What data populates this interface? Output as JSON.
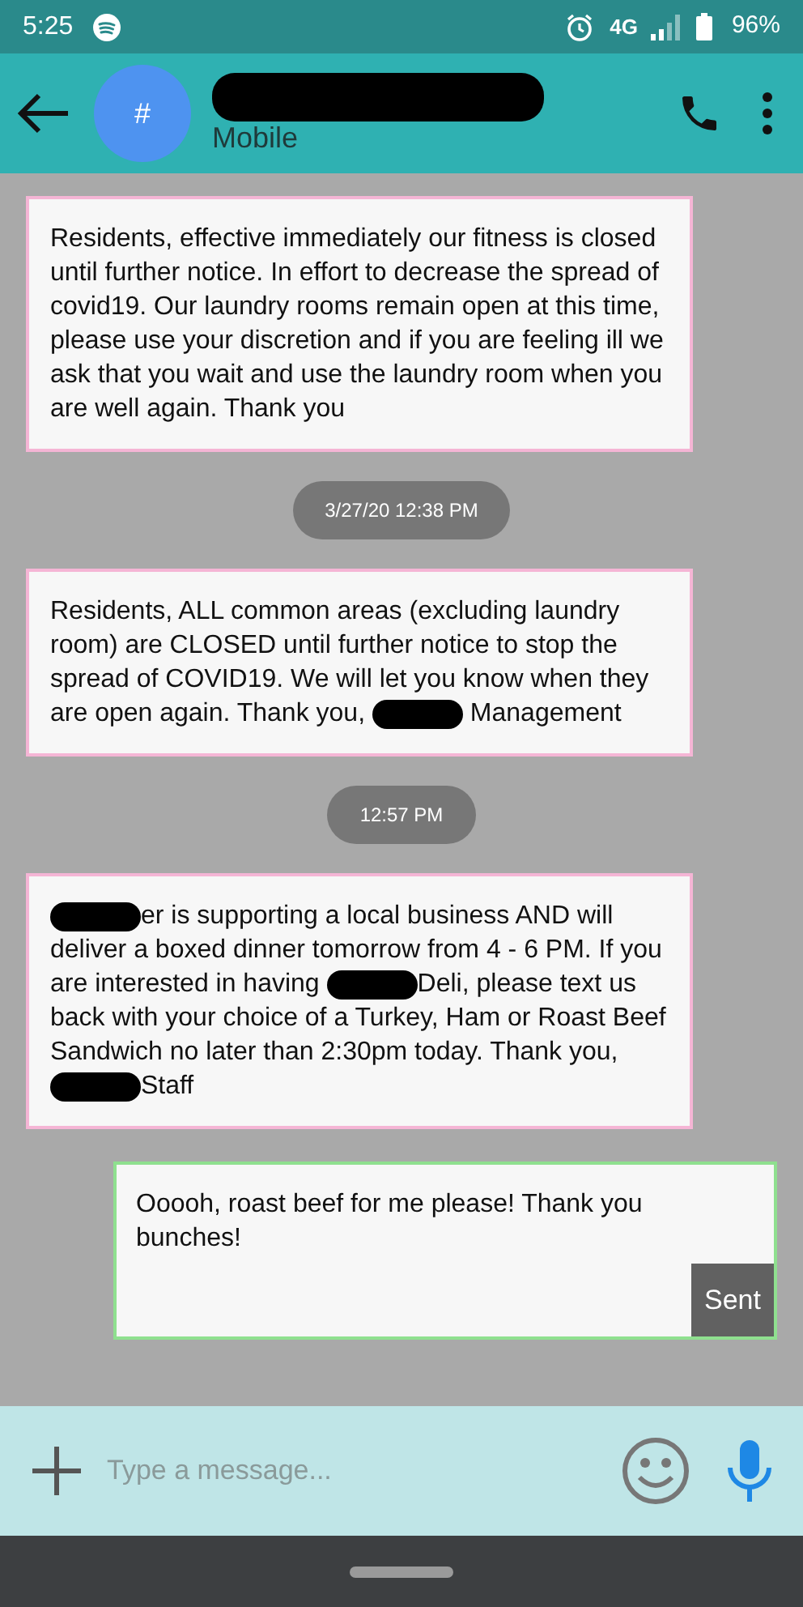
{
  "status_bar": {
    "time": "5:25",
    "network": "4G",
    "battery": "96%"
  },
  "header": {
    "avatar": "#",
    "title_redacted": true,
    "subtitle": "Mobile"
  },
  "messages": [
    {
      "kind": "incoming",
      "segments": [
        {
          "kind": "text",
          "text": "Residents, effective immediately our fitness is closed until further notice. In effort to decrease the spread of covid19. Our laundry rooms remain open at this time, please use your discretion and if you are feeling ill we ask that you wait and use the laundry room when you are well again. Thank you"
        }
      ]
    },
    {
      "kind": "timestamp",
      "text": "3/27/20 12:38 PM"
    },
    {
      "kind": "incoming",
      "segments": [
        {
          "kind": "text",
          "text": "Residents, ALL common areas (excluding laundry room) are CLOSED until further notice to stop the spread of COVID19. We will let you know when they are open again. Thank you, "
        },
        {
          "kind": "redaction"
        },
        {
          "kind": "text",
          "text": " Management"
        }
      ]
    },
    {
      "kind": "timestamp",
      "text": "12:57 PM"
    },
    {
      "kind": "incoming",
      "segments": [
        {
          "kind": "redaction"
        },
        {
          "kind": "text",
          "text": "er is supporting a local business AND will deliver a boxed dinner tomorrow from 4 - 6 PM. If you are interested in having "
        },
        {
          "kind": "redaction"
        },
        {
          "kind": "text",
          "text": "Deli, please text us back with your choice of a Turkey, Ham or Roast Beef Sandwich no later than 2:30pm today. Thank you, "
        },
        {
          "kind": "redaction"
        },
        {
          "kind": "text",
          "text": "Staff"
        }
      ]
    },
    {
      "kind": "outgoing",
      "segments": [
        {
          "kind": "text",
          "text": "Ooooh, roast beef for me please! Thank you bunches!"
        }
      ],
      "status": "Sent"
    }
  ],
  "composer": {
    "placeholder": "Type a message..."
  }
}
